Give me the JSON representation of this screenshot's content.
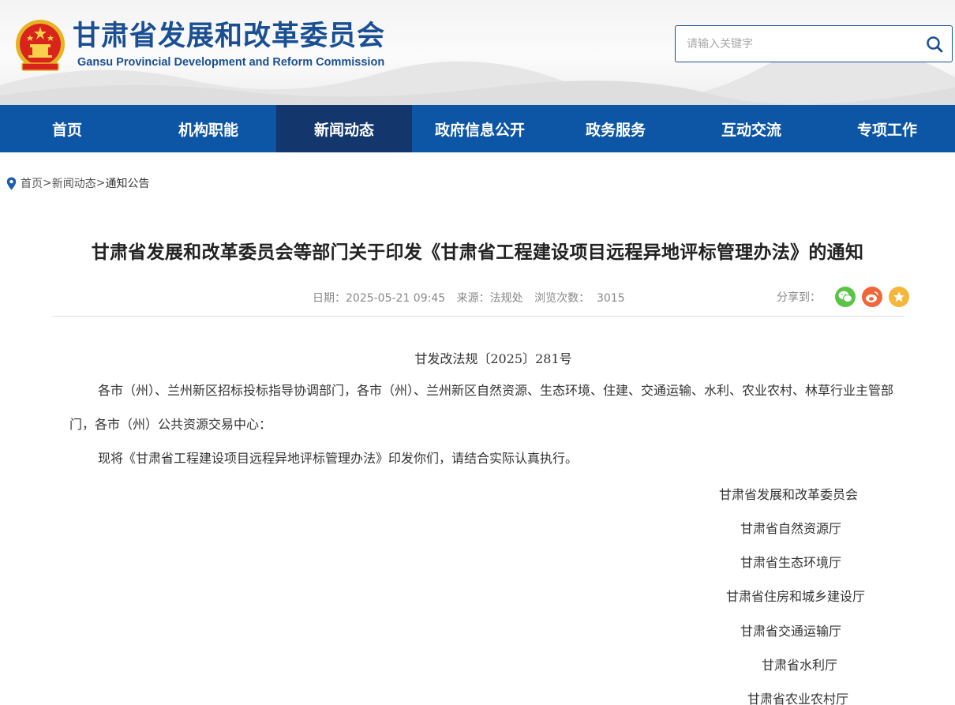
{
  "header": {
    "title": "甘肃省发展和改革委员会",
    "subtitle": "Gansu Provincial Development and Reform Commission",
    "search_placeholder": "请输入关键字",
    "logo_icon": "national-emblem-icon",
    "search_icon": "search-icon"
  },
  "nav": {
    "items": [
      {
        "label": "首页",
        "active": false
      },
      {
        "label": "机构职能",
        "active": false
      },
      {
        "label": "新闻动态",
        "active": true
      },
      {
        "label": "政府信息公开",
        "active": false
      },
      {
        "label": "政务服务",
        "active": false
      },
      {
        "label": "互动交流",
        "active": false
      },
      {
        "label": "专项工作",
        "active": false
      }
    ]
  },
  "breadcrumb": {
    "items": [
      "首页",
      "新闻动态",
      "通知公告"
    ],
    "separator": ">"
  },
  "article": {
    "title": "甘肃省发展和改革委员会等部门关于印发《甘肃省工程建设项目远程异地评标管理办法》的通知",
    "date": "日期：2025-05-21 09:45",
    "source": "来源：法规处",
    "views": "浏览次数：  3015",
    "share_label": "分享到：",
    "share_icons": [
      "wechat-icon",
      "weibo-icon",
      "favorite-icon"
    ],
    "doc_number": "甘发改法规〔2025〕281号",
    "paragraphs": [
      "各市（州）、兰州新区招标投标指导协调部门，各市（州）、兰州新区自然资源、生态环境、住建、交通运输、水利、农业农村、林草行业主管部门，各市（州）公共资源交易中心：",
      "现将《甘肃省工程建设项目远程异地评标管理办法》印发你们，请结合实际认真执行。"
    ],
    "signatures": [
      "甘肃省发展和改革委员会",
      "甘肃省自然资源厅",
      "甘肃省生态环境厅",
      "甘肃省住房和城乡建设厅",
      "甘肃省交通运输厅",
      "甘肃省水利厅",
      "甘肃省农业农村厅"
    ]
  },
  "colors": {
    "brand_blue": "#1a4f94",
    "nav_bg": "#0d56a6",
    "nav_active": "#13366d",
    "wechat": "#5ac544",
    "weibo": "#f0663a",
    "favorite": "#f5b73b"
  }
}
